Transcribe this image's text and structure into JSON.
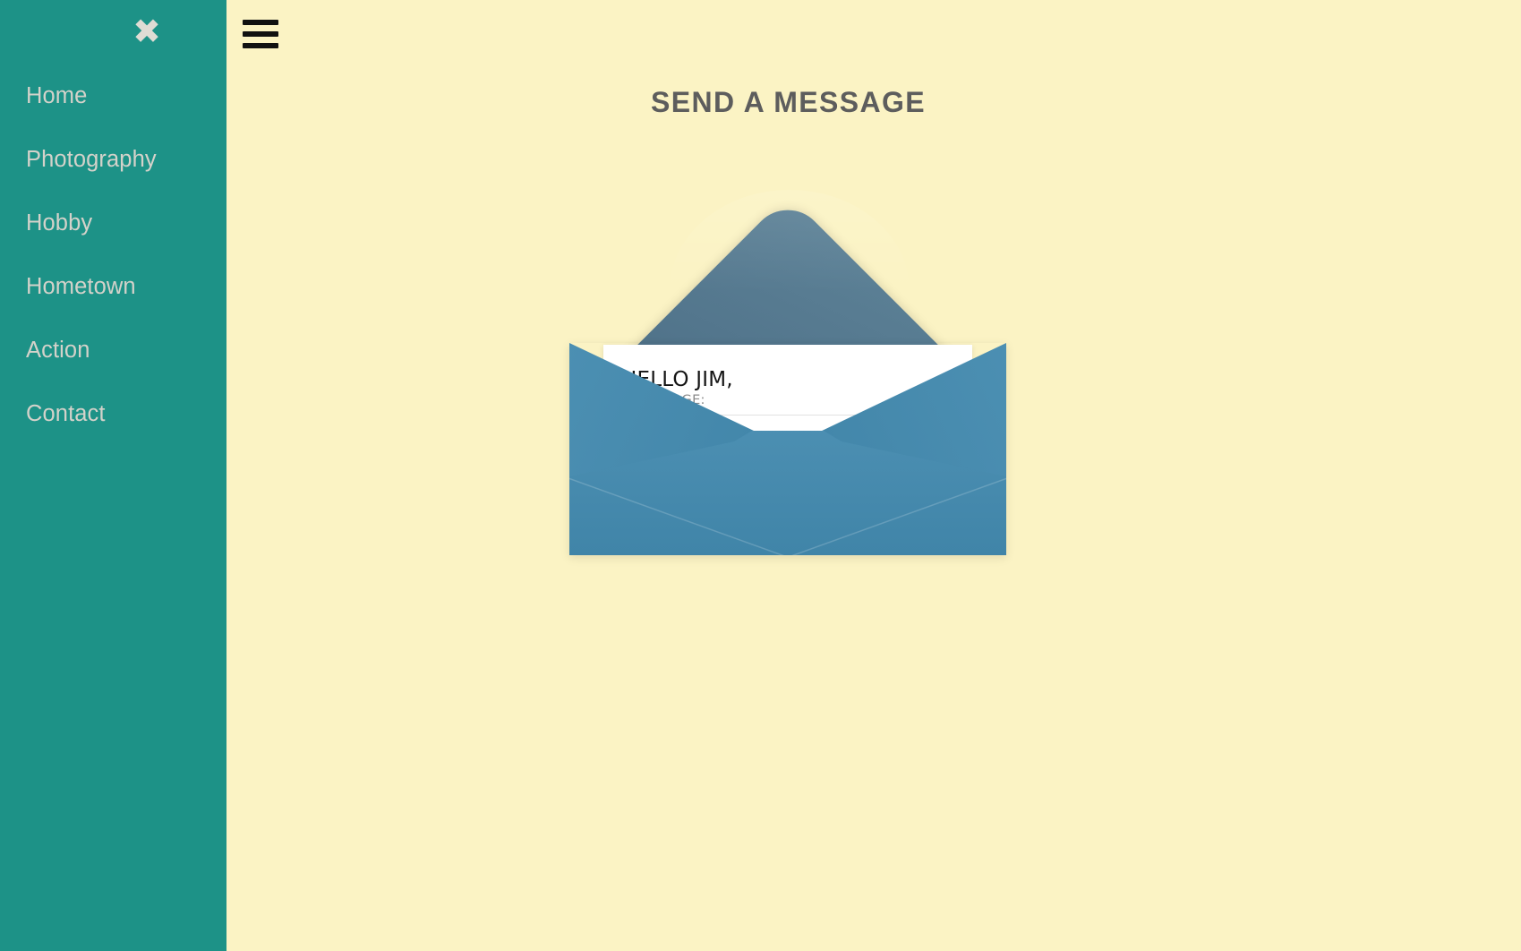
{
  "theme": {
    "background": "#fbf3c4",
    "sidebar_background": "#1d9287",
    "sidebar_text": "#d4d2ca",
    "title_color": "#5d5d5d",
    "envelope_body": "#4289ae",
    "envelope_flap": "#456579",
    "letter_background": "#ffffff"
  },
  "sidebar": {
    "close_icon": "close-icon",
    "close_label": "✖",
    "items": [
      {
        "label": "Home"
      },
      {
        "label": "Photography"
      },
      {
        "label": "Hobby"
      },
      {
        "label": "Hometown"
      },
      {
        "label": "Action"
      },
      {
        "label": "Contact"
      }
    ]
  },
  "main": {
    "menu_icon": "hamburger-menu-icon",
    "title": "SEND A MESSAGE",
    "envelope": {
      "letter": {
        "greeting": "HELLO JIM,",
        "field_label": "R MASSAGE:"
      }
    }
  }
}
